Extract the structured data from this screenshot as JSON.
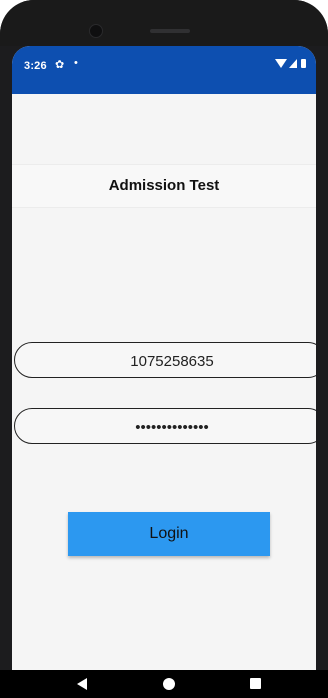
{
  "status_bar": {
    "time": "3:26",
    "settings_icon": "gear-icon",
    "notification_dot": "•",
    "background": "#0d4fb0"
  },
  "header": {
    "title": "Admission Test"
  },
  "login_form": {
    "username_value": "1075258635",
    "password_value": "••••••••••••••",
    "login_label": "Login",
    "button_color": "#2c98f0"
  },
  "nav_bar": {
    "back_icon": "back-triangle-icon",
    "home_icon": "home-circle-icon",
    "recents_icon": "recents-square-icon"
  }
}
